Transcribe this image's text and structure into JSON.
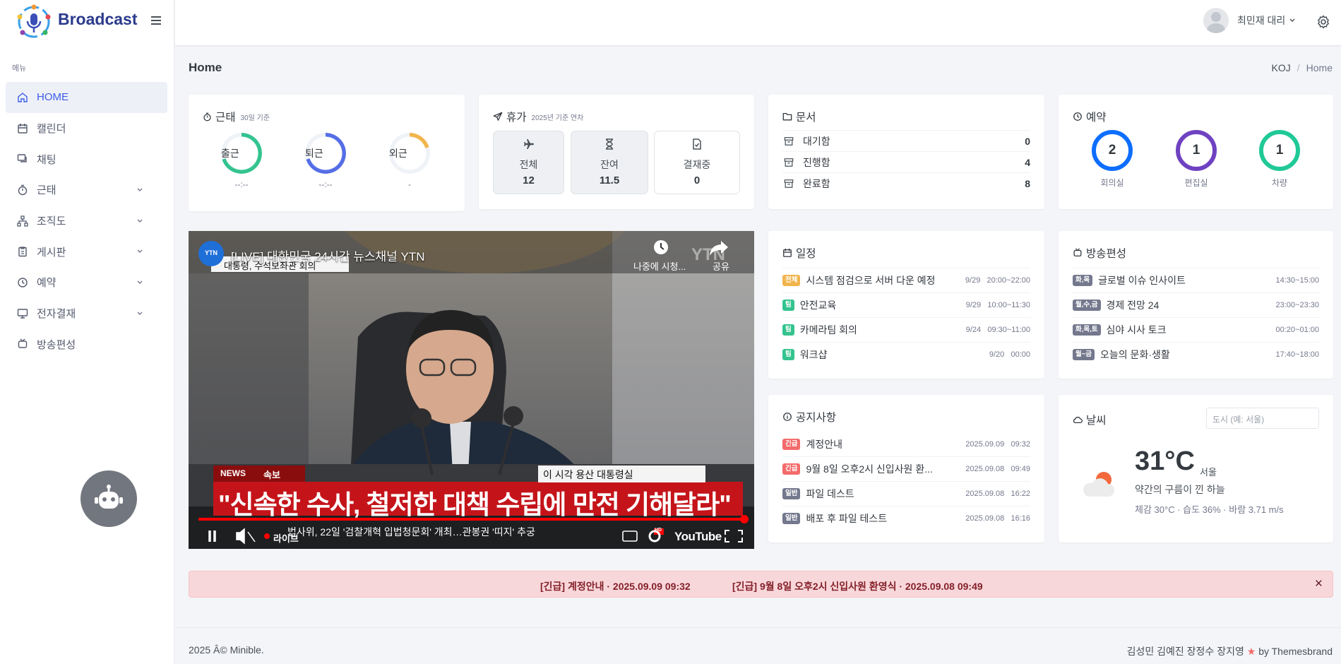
{
  "app": {
    "name": "Broadcast"
  },
  "sidebar": {
    "menu_title": "메뉴",
    "items": [
      {
        "label": "HOME",
        "icon": "home-icon",
        "expandable": false
      },
      {
        "label": "캘린더",
        "icon": "calendar-icon",
        "expandable": false
      },
      {
        "label": "채팅",
        "icon": "chat-icon",
        "expandable": false
      },
      {
        "label": "근태",
        "icon": "timer-icon",
        "expandable": true
      },
      {
        "label": "조직도",
        "icon": "org-chart-icon",
        "expandable": true
      },
      {
        "label": "게시판",
        "icon": "clipboard-icon",
        "expandable": true
      },
      {
        "label": "예약",
        "icon": "clock-icon",
        "expandable": true
      },
      {
        "label": "전자결재",
        "icon": "monitor-icon",
        "expandable": true
      },
      {
        "label": "방송편성",
        "icon": "tv-icon",
        "expandable": false
      }
    ]
  },
  "topbar": {
    "user_name": "최민재 대리"
  },
  "page": {
    "title": "Home",
    "breadcrumb": [
      "KOJ",
      "Home"
    ]
  },
  "attendance": {
    "title": "근태",
    "subtitle": "30일 기준",
    "items": [
      {
        "label": "출근",
        "value": "--:--",
        "color": "#34c38f",
        "progress": 0.7
      },
      {
        "label": "퇴근",
        "value": "--:--",
        "color": "#556ee6",
        "progress": 0.7
      },
      {
        "label": "외근",
        "value": "-",
        "color": "#f1b44c",
        "progress": 0.2
      }
    ]
  },
  "vacation": {
    "title": "휴가",
    "subtitle": "2025년 기준 연차",
    "items": [
      {
        "label": "전체",
        "value": "12",
        "icon": "airplane-icon"
      },
      {
        "label": "잔여",
        "value": "11.5",
        "icon": "hourglass-icon"
      },
      {
        "label": "결재중",
        "value": "0",
        "icon": "file-check-icon"
      }
    ]
  },
  "documents": {
    "title": "문서",
    "rows": [
      {
        "label": "대기함",
        "value": "0"
      },
      {
        "label": "진행함",
        "value": "4"
      },
      {
        "label": "완료함",
        "value": "8"
      }
    ]
  },
  "reservation": {
    "title": "예약",
    "items": [
      {
        "label": "회의실",
        "value": "2",
        "color": "#0d6efd"
      },
      {
        "label": "편집실",
        "value": "1",
        "color": "#6f42c1"
      },
      {
        "label": "차량",
        "value": "1",
        "color": "#20c997"
      }
    ]
  },
  "video": {
    "channel": "YTN",
    "title": "[LIVE] 대한민국 24시간 뉴스채널 YTN",
    "watch_later": "나중에 시청...",
    "share": "공유",
    "caption": "대통령, 수석보좌관 회의",
    "news_label": "NEWS",
    "flash_label": "속보",
    "location": "이 시각 용산 대통령실",
    "headline": "\"신속한 수사, 철저한 대책 수립에 만전 기해달라\"",
    "ticker": "법사위, 22일 '검찰개혁 입법청문회' 개최…관봉권 '띠지' 추궁",
    "live": "라이브",
    "brand": "YouTube",
    "hd": "HD"
  },
  "schedule": {
    "title": "일정",
    "rows": [
      {
        "badge": "전체",
        "type": "all",
        "text": "시스템 점검으로 서버 다운 예정",
        "date": "9/29",
        "time": "20:00~22:00"
      },
      {
        "badge": "팀",
        "type": "team",
        "text": "안전교육",
        "date": "9/29",
        "time": "10:00~11:30"
      },
      {
        "badge": "팀",
        "type": "team",
        "text": "카메라팀 회의",
        "date": "9/24",
        "time": "09:30~11:00"
      },
      {
        "badge": "팀",
        "type": "team",
        "text": "워크샵",
        "date": "9/20",
        "time": "00:00"
      }
    ]
  },
  "broadcast": {
    "title": "방송편성",
    "rows": [
      {
        "badge": "화,목",
        "text": "글로벌 이슈 인사이트",
        "time": "14:30~15:00"
      },
      {
        "badge": "월,수,금",
        "text": "경제 전망 24",
        "time": "23:00~23:30"
      },
      {
        "badge": "화,목,토",
        "text": "심야 시사 토크",
        "time": "00:20~01:00"
      },
      {
        "badge": "월~금",
        "text": "오늘의 문화·생활",
        "time": "17:40~18:00"
      }
    ]
  },
  "notice": {
    "title": "공지사항",
    "rows": [
      {
        "badge": "긴급",
        "type": "urg",
        "text": "계정안내",
        "date": "2025.09.09",
        "time": "09:32"
      },
      {
        "badge": "긴급",
        "type": "urg",
        "text": "9월 8일 오후2시 신입사원 환...",
        "date": "2025.09.08",
        "time": "09:49"
      },
      {
        "badge": "일반",
        "type": "gen",
        "text": "파일 데스트",
        "date": "2025.09.08",
        "time": "16:22"
      },
      {
        "badge": "일반",
        "type": "gen",
        "text": "배포 후 파일 테스트",
        "date": "2025.09.08",
        "time": "16:16"
      }
    ]
  },
  "weather": {
    "title": "날씨",
    "placeholder": "도시 (예: 서울)",
    "temp": "31°C",
    "city": "서울",
    "desc": "약간의 구름이 낀 하늘",
    "detail": "체감 30°C · 습도 36% · 바람 3.71 m/s"
  },
  "alert": {
    "items": [
      "[긴급] 계정안내 · 2025.09.09 09:32",
      "[긴급] 9월 8일 오후2시 신입사원 환영식 · 2025.09.08 09:49"
    ],
    "close": "×"
  },
  "footer": {
    "left": "2025 Â© Minible.",
    "right_names": "김성민 김예진 장정수 장지영",
    "right_by": "by Themesbrand",
    "heart": "★"
  }
}
